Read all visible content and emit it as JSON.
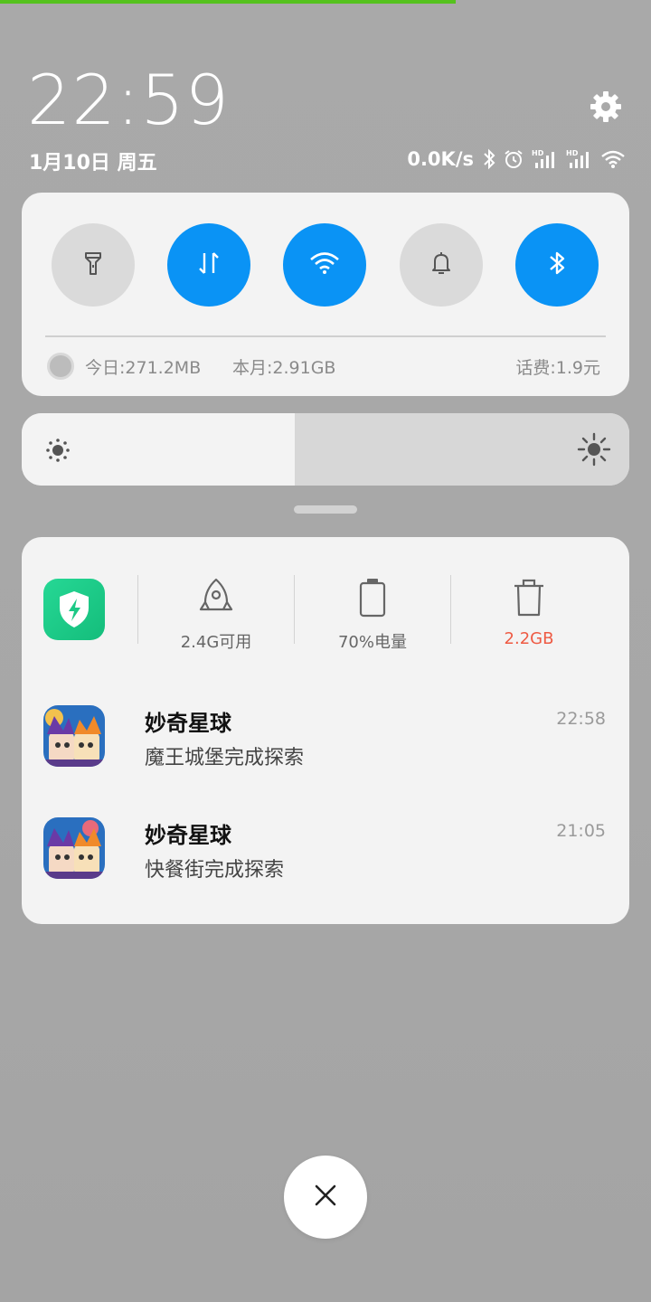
{
  "colors": {
    "accent": "#0a93f5",
    "progress": "#55c21e",
    "warning": "#ee5a43",
    "security_green": "#1cc986"
  },
  "top_progress": 0.7,
  "status_bar": {
    "time": "22:59",
    "date": "1月10日 周五",
    "net_speed": "0.0K/s",
    "icons": [
      "bluetooth-icon",
      "alarm-icon",
      "hd-signal-icon",
      "hd-signal-icon",
      "wifi-icon"
    ]
  },
  "quick_settings": {
    "tiles": [
      {
        "name": "flashlight",
        "icon": "flashlight-icon",
        "active": false
      },
      {
        "name": "mobile-data",
        "icon": "data-arrows-icon",
        "active": true
      },
      {
        "name": "wifi",
        "icon": "wifi-icon",
        "active": true
      },
      {
        "name": "ring",
        "icon": "bell-icon",
        "active": false
      },
      {
        "name": "bluetooth",
        "icon": "bluetooth-icon",
        "active": true
      }
    ],
    "usage": {
      "today": "今日:271.2MB",
      "month": "本月:2.91GB",
      "balance": "话费:1.9元"
    }
  },
  "brightness": {
    "level": 0.45
  },
  "security_panel": {
    "stats": [
      {
        "icon": "rocket-icon",
        "label": "2.4G可用"
      },
      {
        "icon": "battery-icon",
        "label": "70%电量"
      },
      {
        "icon": "trash-icon",
        "label": "2.2GB"
      }
    ]
  },
  "notifications": [
    {
      "app": "妙奇星球",
      "text": "魔王城堡完成探索",
      "time": "22:58"
    },
    {
      "app": "妙奇星球",
      "text": "快餐街完成探索",
      "time": "21:05"
    }
  ]
}
